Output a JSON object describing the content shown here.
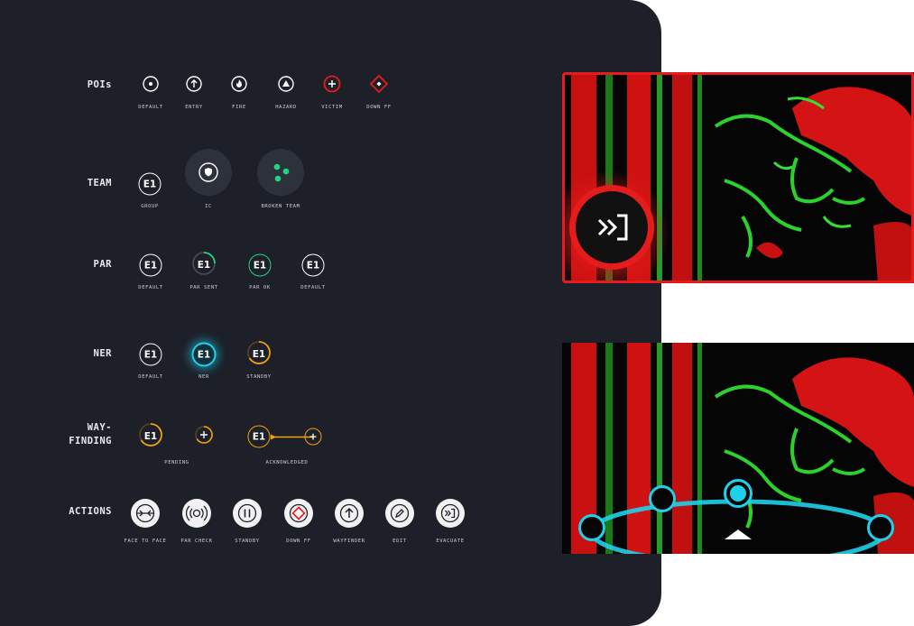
{
  "rows": {
    "pois": {
      "label": "POIs",
      "items": [
        {
          "caption": "DEFAULT",
          "icon": "dot-icon"
        },
        {
          "caption": "ENTRY",
          "icon": "arrow-up-icon"
        },
        {
          "caption": "FIRE",
          "icon": "fire-icon"
        },
        {
          "caption": "HAZARD",
          "icon": "hazard-triangle-icon"
        },
        {
          "caption": "VICTIM",
          "icon": "victim-plus-icon"
        },
        {
          "caption": "DOWN FF",
          "icon": "down-ff-diamond-icon"
        }
      ]
    },
    "team": {
      "label": "TEAM",
      "items": [
        {
          "caption": "GROUP",
          "text": "E1"
        },
        {
          "caption": "IC",
          "icon": "shield-icon"
        },
        {
          "caption": "BROKEN TEAM",
          "icon": "broken-team-dots-icon"
        }
      ]
    },
    "par": {
      "label": "PAR",
      "items": [
        {
          "caption": "DEFAULT",
          "text": "E1"
        },
        {
          "caption": "PAR SENT",
          "text": "E1"
        },
        {
          "caption": "PAR OK",
          "text": "E1"
        },
        {
          "caption": "DEFAULT",
          "text": "E1"
        }
      ]
    },
    "ner": {
      "label": "NER",
      "items": [
        {
          "caption": "DEFAULT",
          "text": "E1"
        },
        {
          "caption": "NER",
          "text": "E1"
        },
        {
          "caption": "STANDBY",
          "text": "E1"
        }
      ]
    },
    "wayfinding": {
      "label_line1": "WAY-",
      "label_line2": "FINDING",
      "pending": {
        "caption": "PENDING",
        "text": "E1",
        "plus": "+"
      },
      "acknowledged": {
        "caption": "ACKNOWLEDGED",
        "text": "E1",
        "plus": "+"
      }
    },
    "actions": {
      "label": "ACTIONS",
      "items": [
        {
          "caption": "FACE TO FACE",
          "icon": "face-to-face-icon"
        },
        {
          "caption": "PAR CHECK",
          "icon": "par-check-icon"
        },
        {
          "caption": "STANDBY",
          "icon": "pause-icon"
        },
        {
          "caption": "DOWN FF",
          "icon": "down-ff-diamond-icon"
        },
        {
          "caption": "WAYFINDER",
          "icon": "arrow-up-icon"
        },
        {
          "caption": "EDIT",
          "icon": "pencil-icon"
        },
        {
          "caption": "EVACUATE",
          "icon": "evacuate-icon"
        }
      ]
    }
  },
  "colors": {
    "panel": "#1d2029",
    "green": "#1fd67a",
    "amber": "#f2a20a",
    "cyan": "#1fd0ea",
    "red": "#e61b1b"
  },
  "previews": {
    "evacuate_preview": {
      "icon": "evacuate-icon"
    },
    "wayfinder_preview": {
      "icon": "radial-menu-icon"
    }
  }
}
